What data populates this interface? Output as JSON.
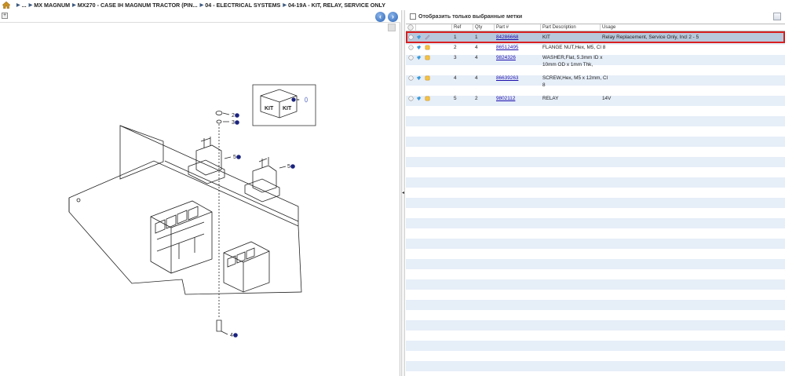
{
  "breadcrumb": {
    "items": [
      "...",
      "MX MAGNUM",
      "MX270 - CASE IH MAGNUM TRACTOR (PIN...",
      "04 - ELECTRICAL SYSTEMS",
      "04-19A - KIT, RELAY, SERVICE ONLY"
    ]
  },
  "parts_panel": {
    "show_selected_label": "Отобразить только выбранные метки",
    "columns": [
      "Ref",
      "Qty",
      "Part #",
      "Part Description",
      "Usage"
    ],
    "rows": [
      {
        "ref": "1",
        "qty": "1",
        "part": "84286668",
        "desc": "KIT",
        "usage": "Relay Replacement, Service Only, Incl 2 - 5",
        "selected": true
      },
      {
        "ref": "2",
        "qty": "4",
        "part": "86512495",
        "desc": "FLANGE NUT,Hex, M5, Cl 8",
        "usage": "",
        "selected": false
      },
      {
        "ref": "3",
        "qty": "4",
        "part": "9824326",
        "desc": "WASHER,Flat, 5.3mm ID x",
        "desc2": "10mm OD x 1mm Thk,",
        "usage": "",
        "selected": false
      },
      {
        "ref": "4",
        "qty": "4",
        "part": "86639263",
        "desc": "SCREW,Hex, M5 x 12mm, Cl",
        "desc2": "8",
        "usage": "",
        "selected": false
      },
      {
        "ref": "5",
        "qty": "2",
        "part": "9802112",
        "desc": "RELAY",
        "usage": "14V",
        "selected": false
      }
    ]
  },
  "diagram": {
    "callouts": [
      "2",
      "3",
      "5",
      "5",
      "4"
    ],
    "kit_label": "KIT",
    "kit_equals": "="
  },
  "colors": {
    "accent": "#2a64b8",
    "selection_border": "#d82020",
    "selection_row": "#b8c8dc",
    "callout": "#1a237e"
  }
}
